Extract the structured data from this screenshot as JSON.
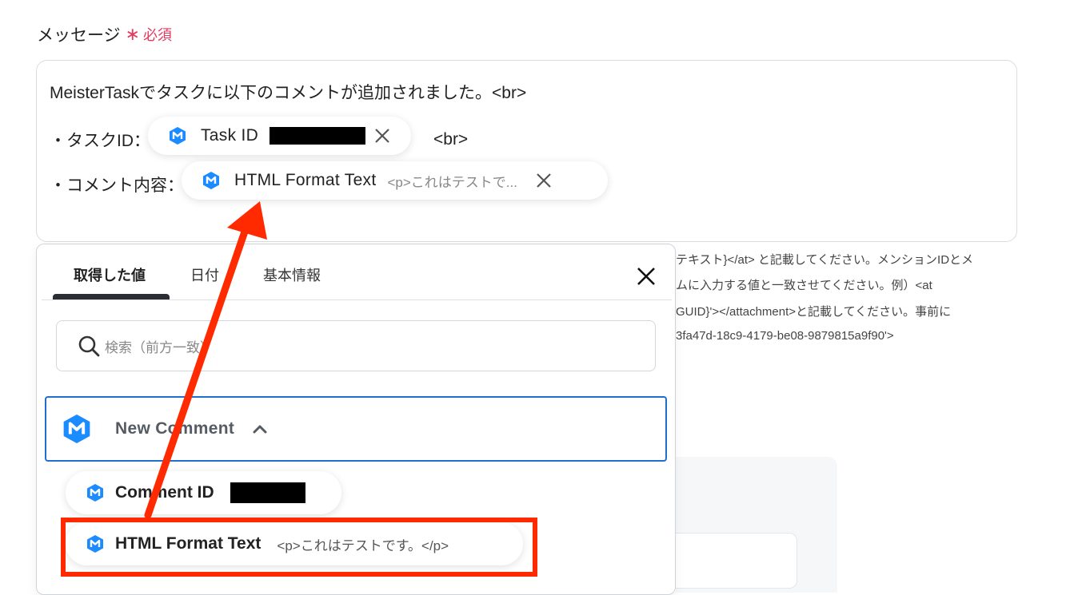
{
  "field": {
    "label": "メッセージ",
    "required_mark": "∗",
    "required_text": "必須"
  },
  "editor": {
    "line1": "MeisterTaskでタスクに以下のコメントが追加されました。<br>",
    "line2_prefix": "・タスクID：",
    "line2_suffix": "<br>",
    "line3_prefix": "・コメント内容：",
    "token_task_id": {
      "name": "Task ID"
    },
    "token_html": {
      "name": "HTML Format Text",
      "sample": "<p>これはテストで..."
    }
  },
  "help_text": [
    "テキスト}</at> と記載してください。メンションIDとメ",
    "ムに入力する値と一致させてください。例）<at",
    "GUID}'></attachment>と記載してください。事前に",
    "3fa47d-18c9-4179-be08-9879815a9f90'>"
  ],
  "panel": {
    "tabs": [
      "取得した値",
      "日付",
      "基本情報"
    ],
    "search_placeholder": "検索（前方一致）",
    "group_name": "New Comment",
    "items": [
      {
        "name": "Comment ID",
        "sample": ""
      },
      {
        "name": "HTML Format Text",
        "sample": "<p>これはテストです。</p>"
      }
    ]
  },
  "colors": {
    "accent": "#1f6fcf",
    "required": "#e6395f",
    "annotation": "#ff2a00",
    "meistertask": "#1a8cff"
  }
}
